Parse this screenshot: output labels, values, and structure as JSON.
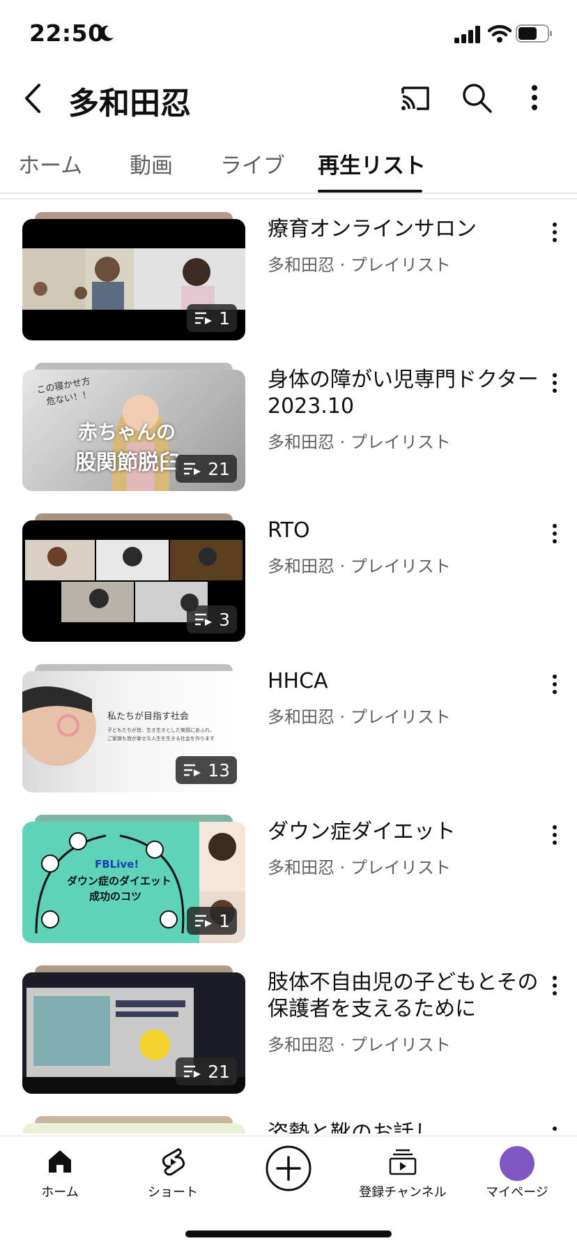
{
  "status_bar": {
    "time": "22:50"
  },
  "header": {
    "title": "多和田忍"
  },
  "tabs": [
    {
      "label": "ホーム"
    },
    {
      "label": "動画"
    },
    {
      "label": "ライブ"
    },
    {
      "label": "再生リスト"
    }
  ],
  "playlists": [
    {
      "title": "療育オンラインサロン",
      "subtitle": "多和田忍 · プレイリスト",
      "count": "1"
    },
    {
      "title": "身体の障がい児専門ドクター2023.10",
      "subtitle": "多和田忍 · プレイリスト",
      "count": "21",
      "thumb_text_1": "この寝かせ方",
      "thumb_text_2": "危ない！！",
      "thumb_text_3": "赤ちゃんの",
      "thumb_text_4": "股関節脱臼"
    },
    {
      "title": "RTO",
      "subtitle": "多和田忍 · プレイリスト",
      "count": "3"
    },
    {
      "title": "HHCA",
      "subtitle": "多和田忍 · プレイリスト",
      "count": "13",
      "thumb_text_1": "私たちが目指す社会",
      "thumb_text_2": "子どもたちが皆、生き生きとした笑顔にあふれ、",
      "thumb_text_3": "ご家族も皆が幸せな人生を生きる社会を作ります"
    },
    {
      "title": "ダウン症ダイエット",
      "subtitle": "多和田忍 · プレイリスト",
      "count": "1",
      "thumb_text_1": "FBLive!",
      "thumb_text_2": "ダウン症のダイエット",
      "thumb_text_3": "成功のコツ"
    },
    {
      "title": "肢体不自由児の子どもとその保護者を支えるために",
      "subtitle": "多和田忍 · プレイリスト",
      "count": "21"
    },
    {
      "title": "姿勢と靴のお話し"
    }
  ],
  "bottom_nav": [
    {
      "label": "ホーム"
    },
    {
      "label": "ショート"
    },
    {
      "label": "登録チャンネル"
    },
    {
      "label": "マイページ"
    }
  ],
  "colors": {
    "accent": "#0f0f0f",
    "secondary_text": "#606060",
    "avatar": "#7e57c2",
    "teal_thumb": "#5fd3b8"
  }
}
